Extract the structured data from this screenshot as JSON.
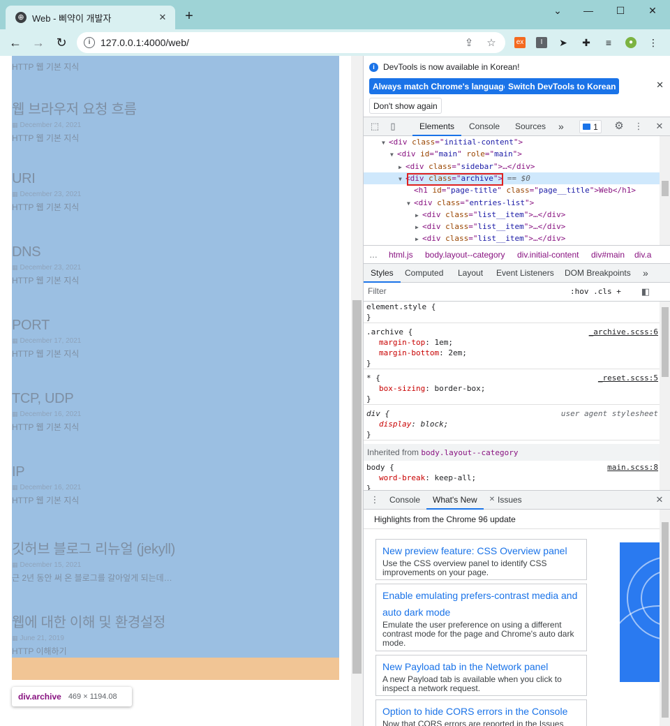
{
  "browser": {
    "tab_title": "Web - 삐약이 개발자",
    "url": "127.0.0.1:4000/web/"
  },
  "page": {
    "top_category": "HTTP 웹 기본 지식",
    "entries": [
      {
        "title": "웹 브라우저 요청 흐름",
        "date": "December 24, 2021",
        "category": "HTTP 웹 기본 지식"
      },
      {
        "title": "URI",
        "date": "December 23, 2021",
        "category": "HTTP 웹 기본 지식"
      },
      {
        "title": "DNS",
        "date": "December 23, 2021",
        "category": "HTTP 웹 기본 지식"
      },
      {
        "title": "PORT",
        "date": "December 17, 2021",
        "category": "HTTP 웹 기본 지식"
      },
      {
        "title": "TCP, UDP",
        "date": "December 16, 2021",
        "category": "HTTP 웹 기본 지식"
      },
      {
        "title": "IP",
        "date": "December 16, 2021",
        "category": "HTTP 웹 기본 지식"
      },
      {
        "title": "깃허브 블로그 리뉴얼 (jekyll)",
        "date": "December 15, 2021",
        "category": "근 2년 동안 써 온 블로그를 갈아엎게 되는데…"
      },
      {
        "title": "웹에 대한 이해 및 환경설정",
        "date": "June 21, 2019",
        "category": "HTTP 이해하기"
      }
    ],
    "tooltip": {
      "tag": "div.archive",
      "dims": "469 × 1194.08"
    }
  },
  "devtools": {
    "info": {
      "message": "DevTools is now available in Korean!",
      "btn_match": "Always match Chrome's language",
      "btn_switch": "Switch DevTools to Korean",
      "btn_dont": "Don't show again"
    },
    "tabs": {
      "elements": "Elements",
      "console": "Console",
      "sources": "Sources",
      "more": "»",
      "issues_count": "1"
    },
    "dom": [
      {
        "indent": 2,
        "arrow": "▼",
        "tag": "div",
        "attrs": [
          [
            "class",
            "initial-content"
          ]
        ],
        "tail": ">"
      },
      {
        "indent": 3,
        "arrow": "▼",
        "tag": "div",
        "attrs": [
          [
            "id",
            "main"
          ],
          [
            "role",
            "main"
          ]
        ],
        "tail": ">"
      },
      {
        "indent": 4,
        "arrow": "▶",
        "tag": "div",
        "attrs": [
          [
            "class",
            "sidebar"
          ]
        ],
        "tail": ">…</div>"
      },
      {
        "indent": 4,
        "arrow": "▼",
        "tag": "div",
        "attrs": [
          [
            "class",
            "archive"
          ]
        ],
        "tail": ">",
        "selected": true,
        "eq": "== $0"
      },
      {
        "indent": 5,
        "arrow": "",
        "tag": "h1",
        "attrs": [
          [
            "id",
            "page-title"
          ],
          [
            "class",
            "page__title"
          ]
        ],
        "tail": ">Web</h1>"
      },
      {
        "indent": 5,
        "arrow": "▼",
        "tag": "div",
        "attrs": [
          [
            "class",
            "entries-list"
          ]
        ],
        "tail": ">"
      },
      {
        "indent": 6,
        "arrow": "▶",
        "tag": "div",
        "attrs": [
          [
            "class",
            "list__item"
          ]
        ],
        "tail": ">…</div>"
      },
      {
        "indent": 6,
        "arrow": "▶",
        "tag": "div",
        "attrs": [
          [
            "class",
            "list__item"
          ]
        ],
        "tail": ">…</div>"
      },
      {
        "indent": 6,
        "arrow": "▶",
        "tag": "div",
        "attrs": [
          [
            "class",
            "list__item"
          ]
        ],
        "tail": ">…</div>"
      }
    ],
    "breadcrumbs": [
      "…",
      "html.js",
      "body.layout--category",
      "div.initial-content",
      "div#main",
      "div.a"
    ],
    "styles_tabs": [
      "Styles",
      "Computed",
      "Layout",
      "Event Listeners",
      "DOM Breakpoints",
      "»"
    ],
    "filter_placeholder": "Filter",
    "filter_tools": ":hov  .cls  +",
    "rules": [
      {
        "selector": "element.style {",
        "src": "",
        "props": []
      },
      {
        "selector": ".archive {",
        "src": "_archive.scss:6",
        "props": [
          [
            "margin-top",
            "1em"
          ],
          [
            "margin-bottom",
            "2em"
          ]
        ]
      },
      {
        "selector": "* {",
        "src": "_reset.scss:5",
        "props": [
          [
            "box-sizing",
            "border-box"
          ]
        ]
      },
      {
        "selector": "div {",
        "src": "user agent stylesheet",
        "ua": true,
        "props": [
          [
            "display",
            "block"
          ]
        ]
      }
    ],
    "inherited": {
      "label": "Inherited from",
      "from": "body.layout--category"
    },
    "body_rule": {
      "selector": "body {",
      "src": "main.scss:8",
      "props": [
        [
          "word-break",
          "keep-all"
        ]
      ]
    },
    "drawer": {
      "tabs": [
        "Console",
        "What's New",
        "Issues"
      ],
      "highlights": "Highlights from the Chrome 96 update",
      "news": [
        {
          "title": "New preview feature: CSS Overview panel",
          "body": "Use the CSS overview panel to identify CSS improvements on your page."
        },
        {
          "title": "Enable emulating prefers-contrast media and auto dark mode",
          "body": "Emulate the user preference on using a different contrast mode for the page and Chrome's auto dark mode."
        },
        {
          "title": "New Payload tab in the Network panel",
          "body": "A new Payload tab is available when you click to inspect a network request."
        },
        {
          "title": "Option to hide CORS errors in the Console",
          "body": "Now that CORS errors are reported in the Issues"
        }
      ]
    }
  },
  "colors": {
    "titlebar": "#9ed3d6",
    "overlay_content": "#9bbfe2",
    "overlay_margin": "#f1c595",
    "accent": "#1a73e8"
  }
}
